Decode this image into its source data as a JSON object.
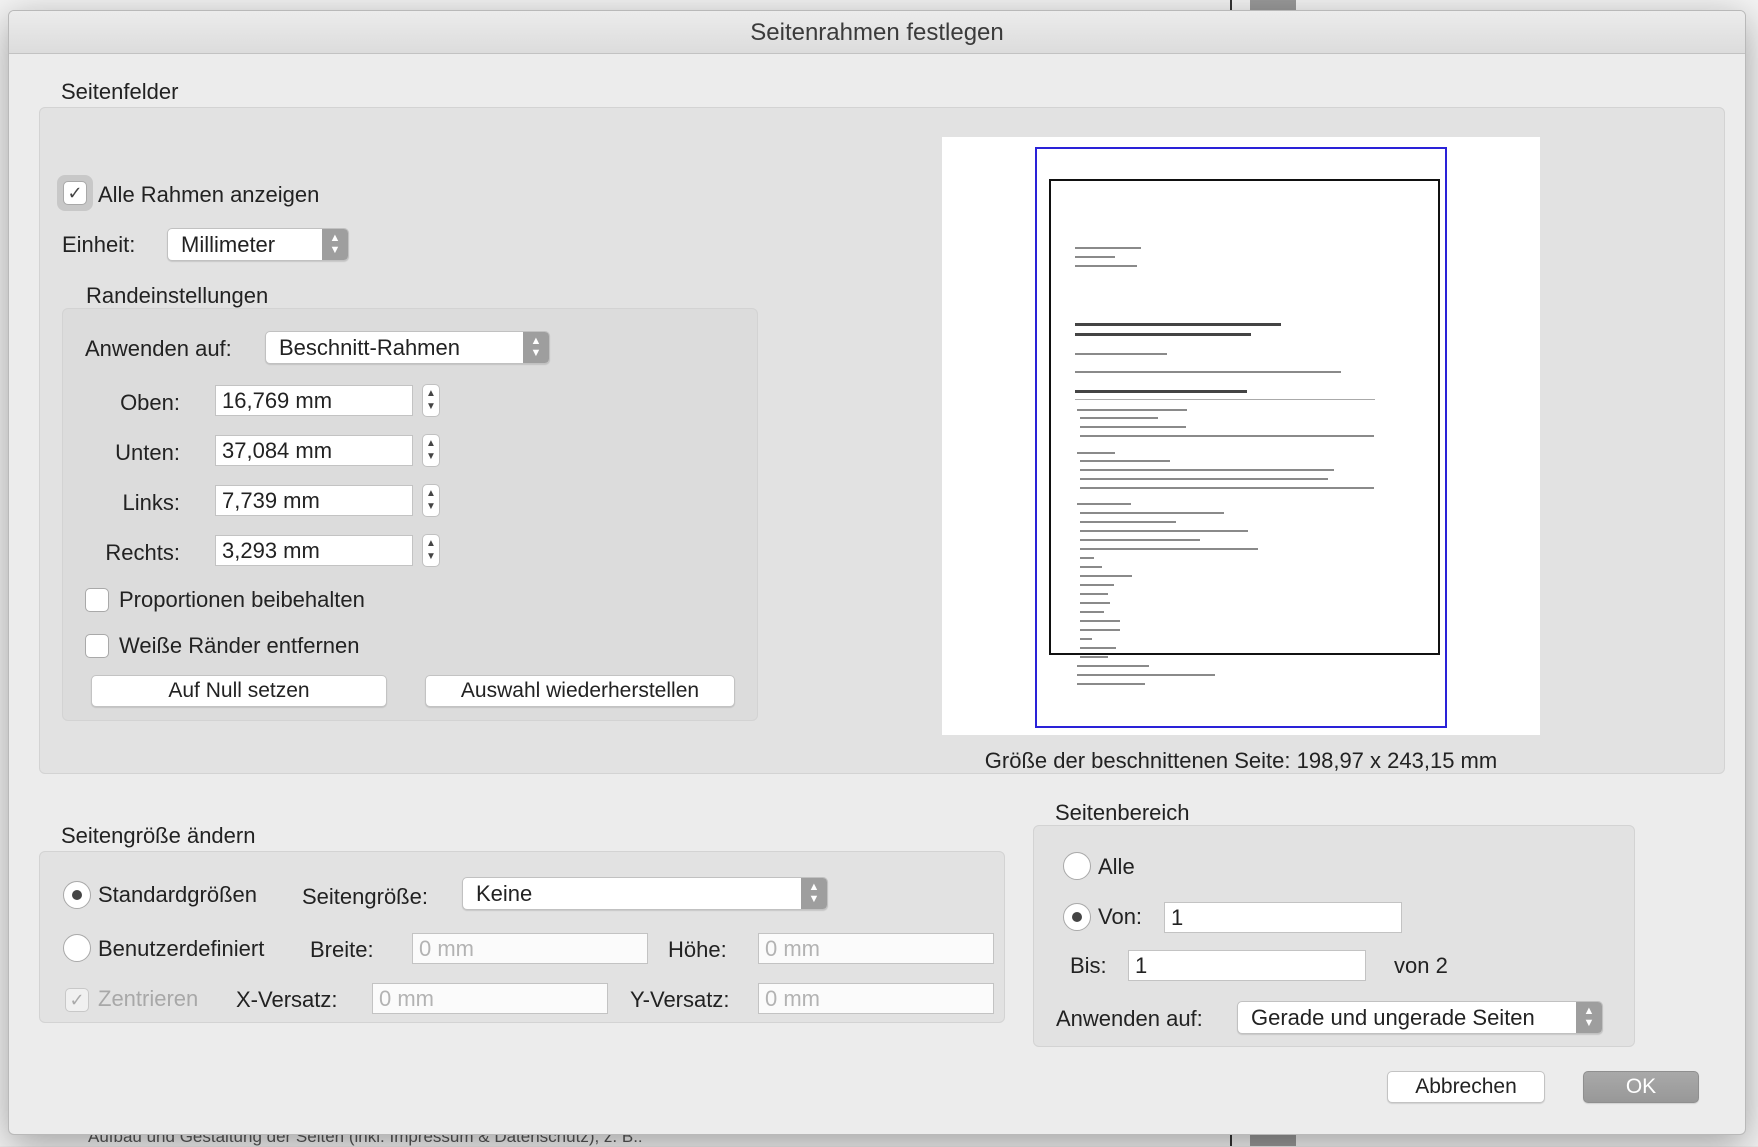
{
  "background": {
    "footer_text": "Aufbau und Gestaltung der Seiten (inkl. Impressum & Datenschutz), z. B.:"
  },
  "dialog": {
    "title": "Seitenrahmen festlegen"
  },
  "seitenfelder": {
    "label": "Seitenfelder",
    "show_all_label": "Alle Rahmen anzeigen",
    "show_all_checked": true,
    "unit_label": "Einheit:",
    "unit_value": "Millimeter",
    "randeinstellungen": {
      "label": "Randeinstellungen",
      "apply_label": "Anwenden auf:",
      "apply_value": "Beschnitt-Rahmen",
      "fields": [
        {
          "label": "Oben:",
          "value": "16,769 mm"
        },
        {
          "label": "Unten:",
          "value": "37,084 mm"
        },
        {
          "label": "Links:",
          "value": "7,739 mm"
        },
        {
          "label": "Rechts:",
          "value": "3,293 mm"
        }
      ],
      "keep_proportions_label": "Proportionen beibehalten",
      "keep_proportions_checked": false,
      "remove_white_label": "Weiße Ränder entfernen",
      "remove_white_checked": false,
      "reset_button": "Auf Null setzen",
      "restore_button": "Auswahl wiederherstellen"
    },
    "preview_caption": "Größe der beschnittenen Seite: 198,97 x 243,15 mm"
  },
  "seitengroesse": {
    "label": "Seitengröße ändern",
    "standard_label": "Standardgrößen",
    "standard_selected": true,
    "page_size_label": "Seitengröße:",
    "page_size_value": "Keine",
    "custom_label": "Benutzerdefiniert",
    "custom_selected": false,
    "width_label": "Breite:",
    "width_placeholder": "0 mm",
    "height_label": "Höhe:",
    "height_placeholder": "0 mm",
    "center_label": "Zentrieren",
    "center_checked": true,
    "x_offset_label": "X-Versatz:",
    "x_offset_placeholder": "0 mm",
    "y_offset_label": "Y-Versatz:",
    "y_offset_placeholder": "0 mm"
  },
  "seitenbereich": {
    "label": "Seitenbereich",
    "all_label": "Alle",
    "all_selected": false,
    "from_label": "Von:",
    "from_selected": true,
    "from_value": "1",
    "to_label": "Bis:",
    "to_value": "1",
    "of_text": "von 2",
    "apply_label": "Anwenden auf:",
    "apply_value": "Gerade und ungerade Seiten"
  },
  "buttons": {
    "cancel": "Abbrechen",
    "ok": "OK"
  },
  "icons": {
    "checkmark": "checkmark-icon",
    "chevron_updown": "chevron-updown-icon"
  }
}
